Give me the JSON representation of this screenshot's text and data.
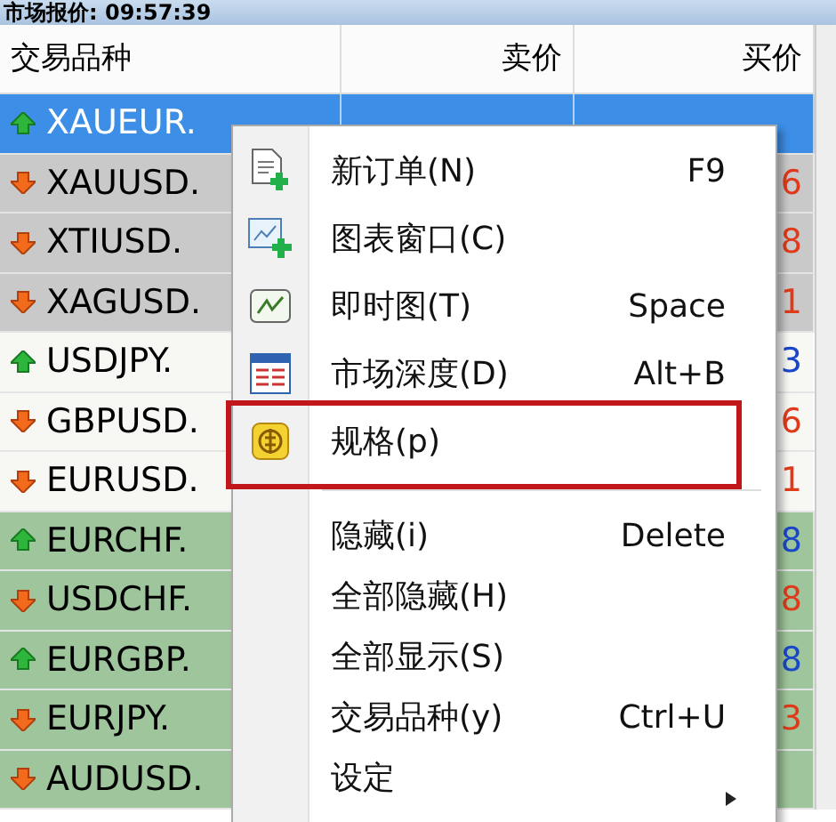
{
  "window": {
    "title": "市场报价: 09:57:39"
  },
  "table": {
    "columns": [
      "交易品种",
      "卖价",
      "买价"
    ],
    "rows": [
      {
        "symbol": "XAUEUR.",
        "rising": true,
        "color": "#3d8ee6",
        "selected": true
      },
      {
        "symbol": "XAUUSD.",
        "rising": false,
        "ask": "6",
        "color": "#c9c9c9",
        "selected": false
      },
      {
        "symbol": "XTIUSD.",
        "rising": false,
        "ask": "8",
        "color": "#c9c9c9",
        "selected": false
      },
      {
        "symbol": "XAGUSD.",
        "rising": false,
        "ask": "1",
        "color": "#c9c9c9",
        "selected": false
      },
      {
        "symbol": "USDJPY.",
        "rising": true,
        "ask": "3",
        "color": "#f7f7f4",
        "selected": false
      },
      {
        "symbol": "GBPUSD.",
        "rising": false,
        "ask": "6",
        "color": "#f7f7f4",
        "selected": false
      },
      {
        "symbol": "EURUSD.",
        "rising": false,
        "ask": "1",
        "color": "#f7f7f4",
        "selected": false
      },
      {
        "symbol": "EURCHF.",
        "rising": true,
        "ask": "8",
        "color": "#9ec59b",
        "selected": false
      },
      {
        "symbol": "USDCHF.",
        "rising": false,
        "ask": "8",
        "color": "#9ec59b",
        "selected": false
      },
      {
        "symbol": "EURGBP.",
        "rising": true,
        "ask": "8",
        "color": "#9ec59b",
        "selected": false
      },
      {
        "symbol": "EURJPY.",
        "rising": false,
        "ask": "3",
        "color": "#9ec59b",
        "selected": false
      },
      {
        "symbol": "AUDUSD.",
        "rising": false,
        "color": "#9ec59b",
        "selected": false
      }
    ]
  },
  "context_menu": {
    "items": [
      {
        "kind": "item",
        "label": "新订单(N)",
        "shortcut": "F9",
        "highlighted": false
      },
      {
        "kind": "item",
        "label": "图表窗口(C)",
        "highlighted": false
      },
      {
        "kind": "item",
        "label": "即时图(T)",
        "shortcut": "Space",
        "highlighted": false
      },
      {
        "kind": "item",
        "label": "市场深度(D)",
        "shortcut": "Alt+B",
        "highlighted": false
      },
      {
        "kind": "item",
        "label": "规格(p)",
        "highlighted": true
      },
      {
        "kind": "separator"
      },
      {
        "kind": "item",
        "label": "隐藏(i)",
        "shortcut": "Delete",
        "highlighted": false
      },
      {
        "kind": "item",
        "label": "全部隐藏(H)",
        "highlighted": false
      },
      {
        "kind": "item",
        "label": "全部显示(S)",
        "highlighted": false
      },
      {
        "kind": "item",
        "label": "交易品种(y)",
        "shortcut": "Ctrl+U",
        "highlighted": false
      },
      {
        "kind": "submenu",
        "label": "设定",
        "highlighted": false
      }
    ]
  }
}
